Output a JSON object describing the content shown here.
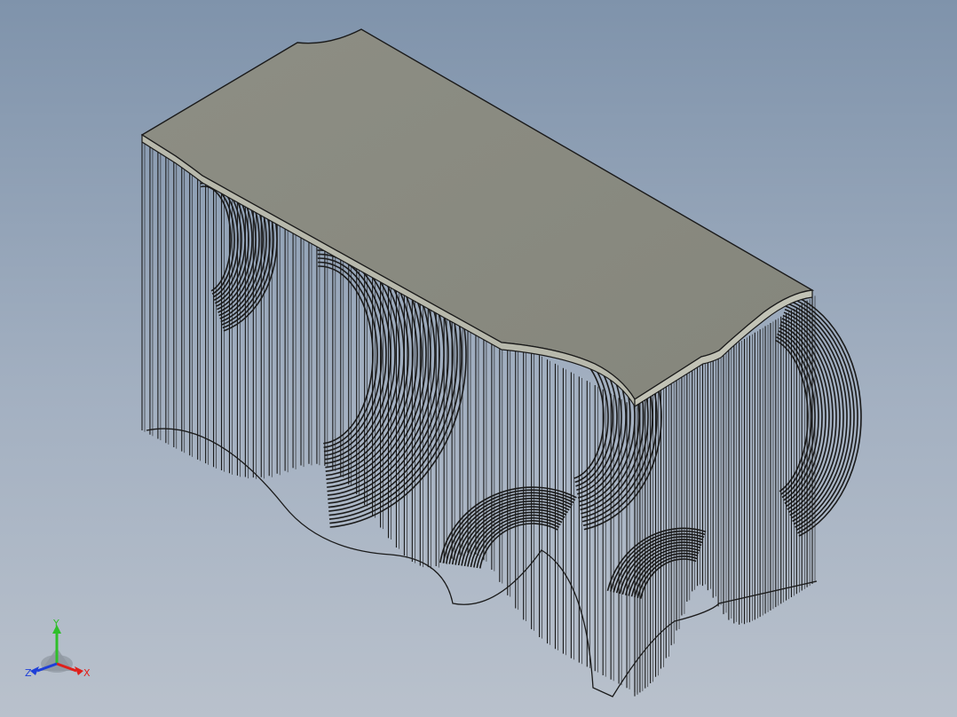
{
  "viewport": {
    "background_top": "#7f93ab",
    "background_bottom": "#b9c1cc"
  },
  "model": {
    "part_color": "#8b8c82",
    "edge_color": "#1a1a1a",
    "top_face_color": "#898a80",
    "side_face_color": "#b6b7aa"
  },
  "triad": {
    "x_label": "X",
    "y_label": "Y",
    "z_label": "Z",
    "x_color": "#e0201b",
    "y_color": "#2fbf2a",
    "z_color": "#1e3fd8"
  }
}
